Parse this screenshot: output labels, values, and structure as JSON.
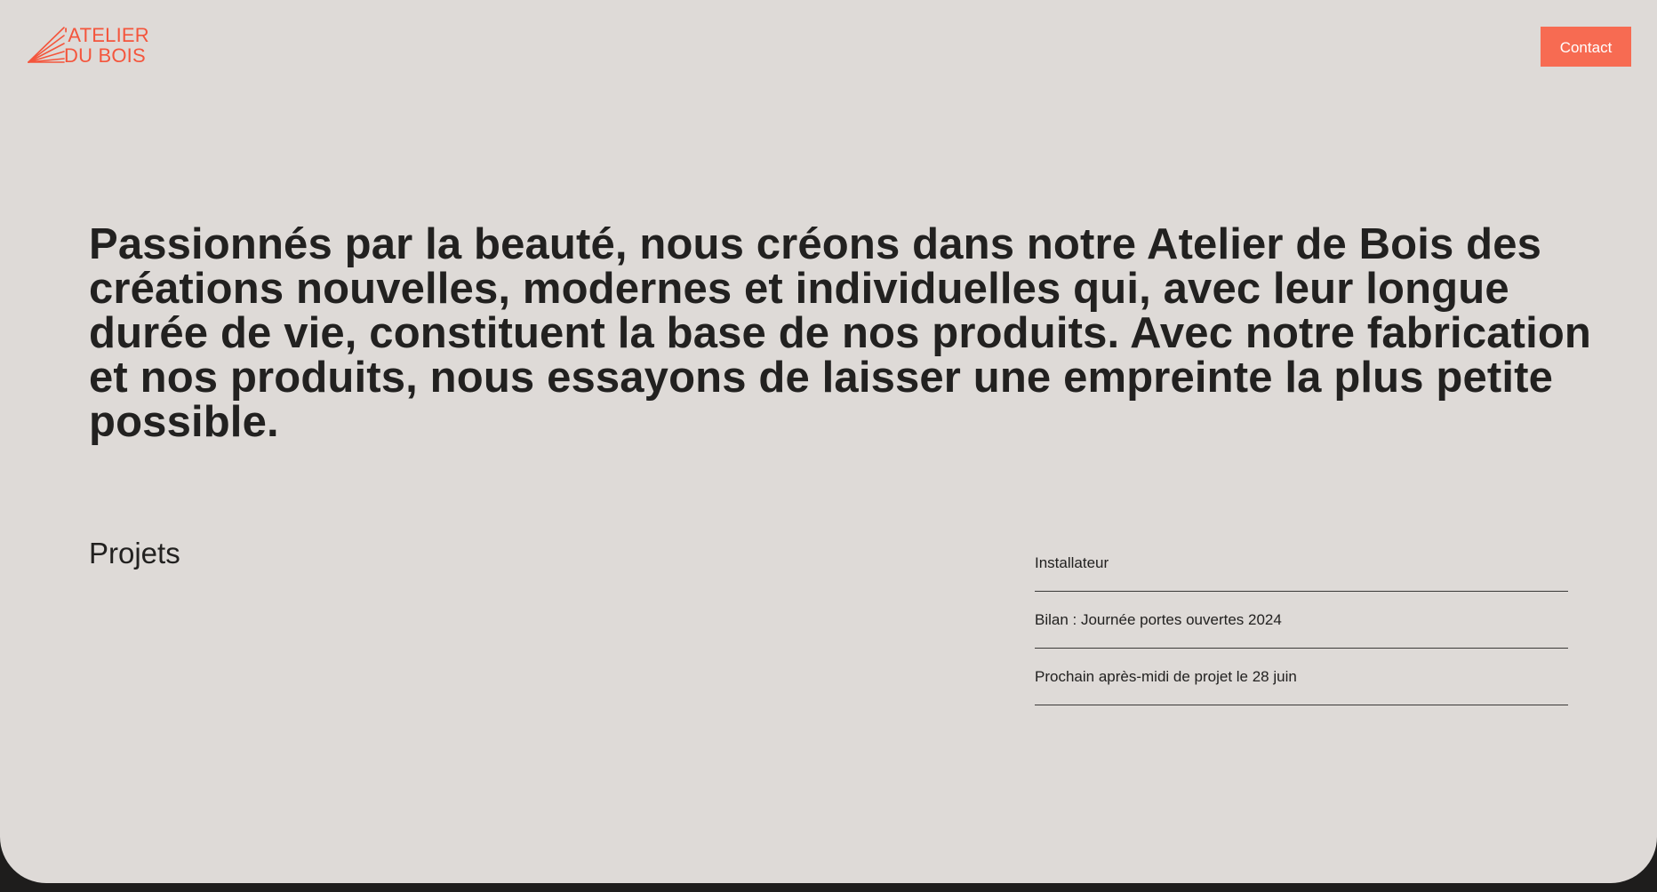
{
  "header": {
    "logo": {
      "icon": "wood-grain-logo-icon",
      "line1": "'ATELIER",
      "line2": "DU BOIS",
      "color": "#f4553c"
    },
    "contact_label": "Contact",
    "contact_color": "#f76b52"
  },
  "intro": {
    "text": "Passionnés par la beauté, nous créons dans notre Atelier de Bois des créations nouvelles, modernes et individuelles qui, avec leur longue durée de vie, constituent la base de nos produits. Avec notre fabrication et nos produits, nous essayons de laisser une empreinte la plus petite possible."
  },
  "projects": {
    "title": "Projets",
    "items": [
      {
        "label": "Installateur"
      },
      {
        "label": "Bilan : Journée portes ouvertes 2024"
      },
      {
        "label": "Prochain après-midi de projet le 28 juin"
      }
    ]
  },
  "colors": {
    "background": "#dedad7",
    "footer": "#1e1d1c",
    "text": "#222120"
  }
}
